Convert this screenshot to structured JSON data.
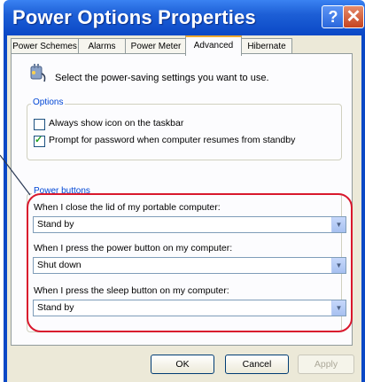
{
  "window": {
    "title": "Power Options Properties",
    "help_glyph": "?",
    "close_glyph": "✕"
  },
  "tabs": [
    {
      "label": "Power Schemes"
    },
    {
      "label": "Alarms"
    },
    {
      "label": "Power Meter"
    },
    {
      "label": "Advanced",
      "active": true
    },
    {
      "label": "Hibernate"
    }
  ],
  "description": "Select the power-saving settings you want to use.",
  "options": {
    "title": "Options",
    "items": [
      {
        "label": "Always show icon on the taskbar",
        "checked": false
      },
      {
        "label": "Prompt for password when computer resumes from standby",
        "checked": true
      }
    ]
  },
  "power_buttons": {
    "title": "Power buttons",
    "fields": [
      {
        "label": "When I close the lid of my portable computer:",
        "value": "Stand by"
      },
      {
        "label": "When I press the power button on my computer:",
        "value": "Shut down"
      },
      {
        "label": "When I press the sleep button on my computer:",
        "value": "Stand by"
      }
    ]
  },
  "buttons": {
    "ok": "OK",
    "cancel": "Cancel",
    "apply": "Apply"
  },
  "icons": {
    "dropdown": "▼",
    "check": "✓"
  },
  "colors": {
    "titlebar": "#0a48c6",
    "highlight": "#d9182d",
    "group_title": "#0046d5"
  }
}
